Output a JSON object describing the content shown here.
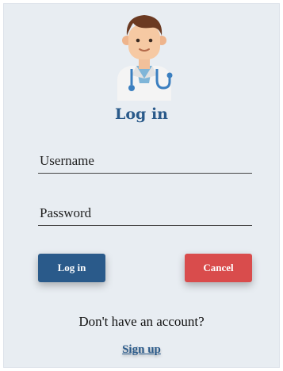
{
  "header": {
    "avatar_icon": "doctor-avatar-icon",
    "title": "Log in"
  },
  "form": {
    "username_placeholder": "Username",
    "password_placeholder": "Password"
  },
  "actions": {
    "login_label": "Log in",
    "cancel_label": "Cancel"
  },
  "footer": {
    "prompt": "Don't have an account?",
    "signup_label": "Sign up"
  },
  "colors": {
    "background": "#e8edf2",
    "primary": "#2a5a8a",
    "danger": "#d94c4c"
  }
}
